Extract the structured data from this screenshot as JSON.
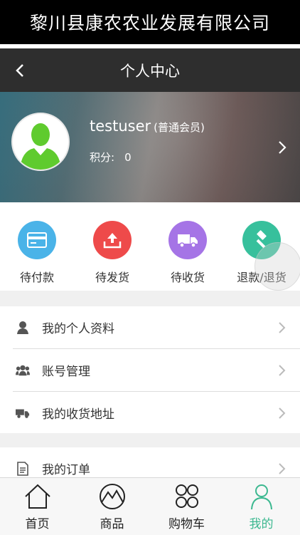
{
  "banner": {
    "title": "黎川县康农农业发展有限公司"
  },
  "navbar": {
    "title": "个人中心"
  },
  "profile": {
    "username": "testuser",
    "level": "(普通会员)",
    "points_label": "积分:",
    "points_value": "0"
  },
  "orders": [
    {
      "label": "待付款",
      "icon": "card-icon",
      "color": "#4ab3e8"
    },
    {
      "label": "待发货",
      "icon": "upload-tray-icon",
      "color": "#ee4a4a"
    },
    {
      "label": "待收货",
      "icon": "truck-icon",
      "color": "#a574e6"
    },
    {
      "label": "退款/退货",
      "icon": "gavel-icon",
      "color": "#37c09c"
    }
  ],
  "menu": [
    {
      "label": "我的个人资料",
      "icon": "person-icon"
    },
    {
      "label": "账号管理",
      "icon": "users-icon"
    },
    {
      "label": "我的收货地址",
      "icon": "truck-icon"
    },
    {
      "label": "我的订单",
      "icon": "document-icon"
    }
  ],
  "tabbar": [
    {
      "label": "首页",
      "icon": "home-icon",
      "active": false
    },
    {
      "label": "商品",
      "icon": "mountain-icon",
      "active": false
    },
    {
      "label": "购物车",
      "icon": "circles-icon",
      "active": false
    },
    {
      "label": "我的",
      "icon": "profile-icon",
      "active": true
    }
  ],
  "colors": {
    "active_tab": "#3cb890",
    "navbar_bg": "#2e2e2e",
    "banner_bg": "#000000"
  }
}
